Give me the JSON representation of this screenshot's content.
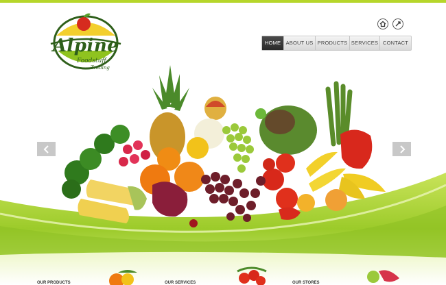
{
  "logo": {
    "name": "Alpine",
    "line1": "Foodstuff",
    "line2": "Trading"
  },
  "utility": {
    "home_icon": "home-icon",
    "sitemap_icon": "sitemap-icon"
  },
  "nav": {
    "items": [
      {
        "label": "HOME",
        "active": true
      },
      {
        "label": "ABOUT US",
        "active": false
      },
      {
        "label": "PRODUCTS",
        "active": false
      },
      {
        "label": "SERVICES",
        "active": false
      },
      {
        "label": "CONTACT",
        "active": false
      }
    ]
  },
  "slider": {
    "prev_icon": "chevron-left-icon",
    "next_icon": "chevron-right-icon"
  },
  "bottom": {
    "labels": [
      "OUR PRODUCTS",
      "OUR SERVICES",
      "OUR STORES"
    ]
  },
  "colors": {
    "brand_green": "#8fc31f",
    "dark_green": "#2e5f1a",
    "accent_red": "#d62b1f"
  }
}
